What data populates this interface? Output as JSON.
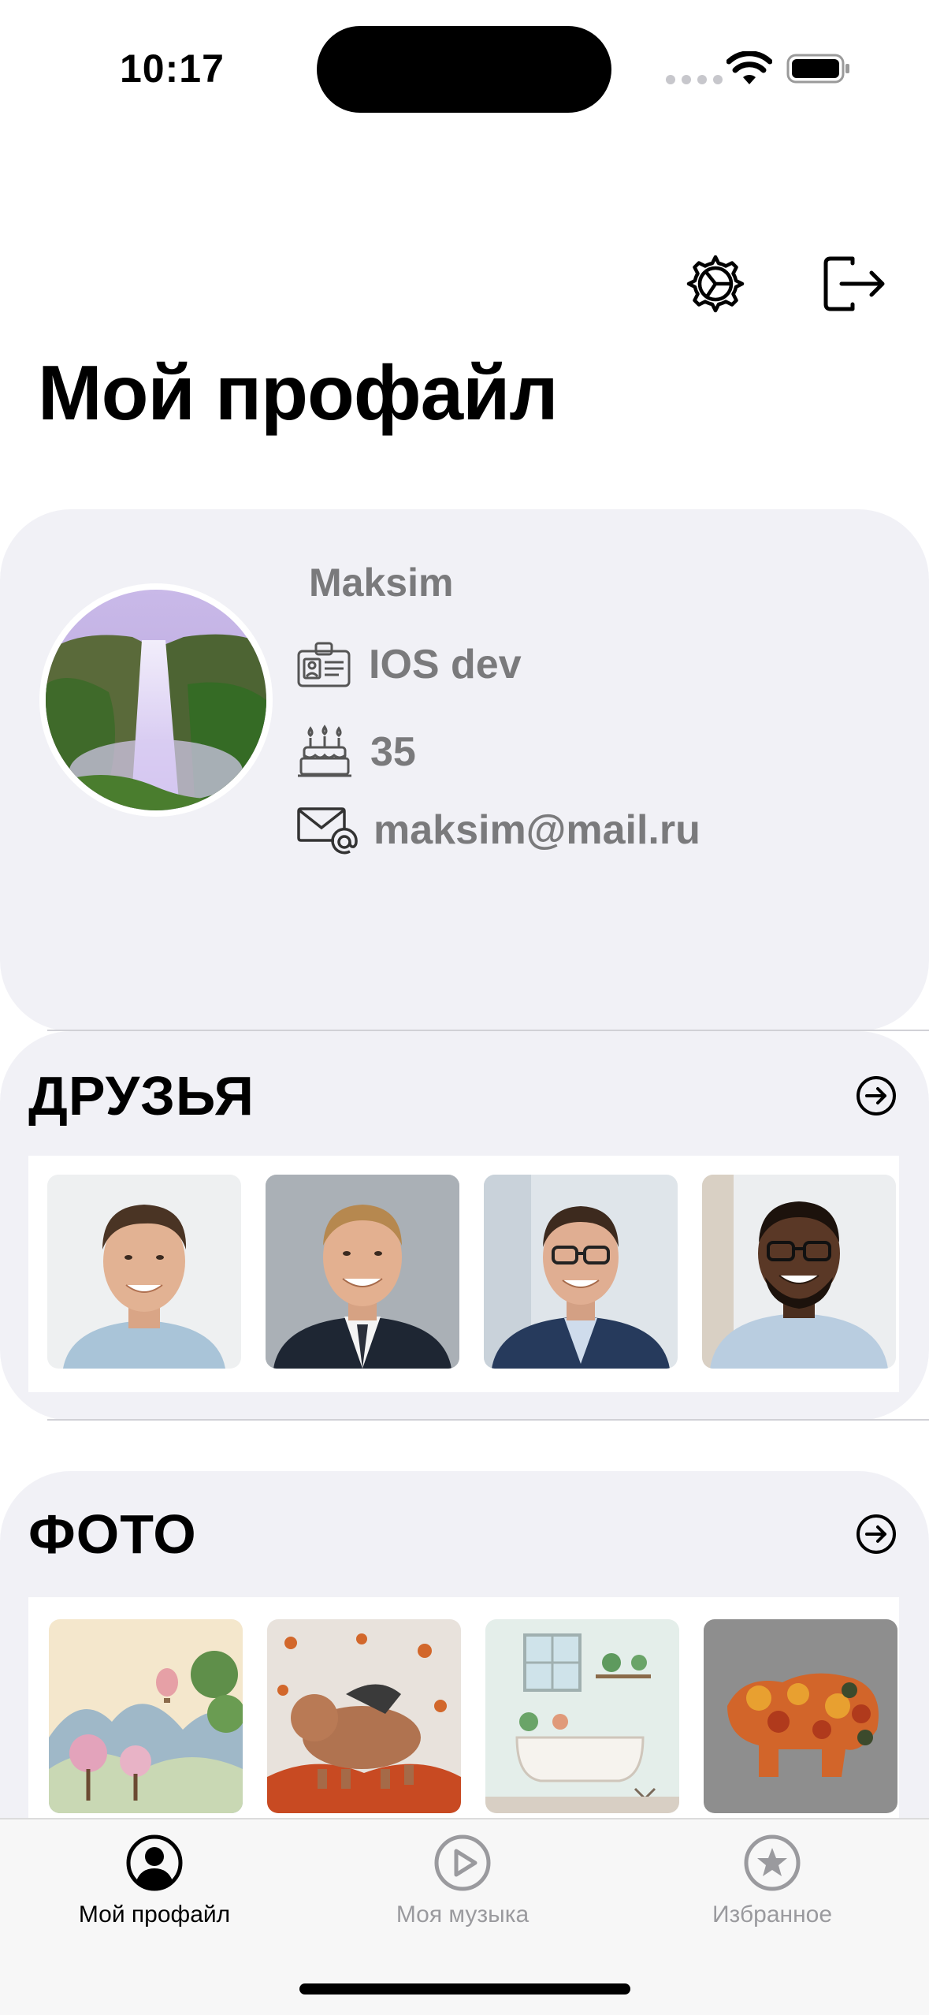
{
  "status_bar": {
    "time": "10:17"
  },
  "header": {
    "title": "Мой профайл"
  },
  "profile": {
    "name": "Maksim",
    "job": "IOS dev",
    "age": "35",
    "email": "maksim@mail.ru"
  },
  "friends": {
    "title": "ДРУЗЬЯ",
    "items": [
      "friend-photo-1",
      "friend-photo-2",
      "friend-photo-3",
      "friend-photo-4"
    ]
  },
  "photos": {
    "title": "ФОТО",
    "items": [
      "photo-landscape",
      "photo-dog-leaves",
      "photo-bathroom",
      "photo-autumn-leaves"
    ]
  },
  "tab_bar": {
    "tabs": [
      {
        "label": "Мой профайл",
        "icon": "person-circle-icon",
        "active": true
      },
      {
        "label": "Моя музыка",
        "icon": "play-circle-icon",
        "active": false
      },
      {
        "label": "Избранное",
        "icon": "star-circle-icon",
        "active": false
      }
    ]
  },
  "colors": {
    "card_bg": "#f1f1f6",
    "secondary_text": "#7a7a7c",
    "inactive_tab": "#9a9a9e"
  }
}
